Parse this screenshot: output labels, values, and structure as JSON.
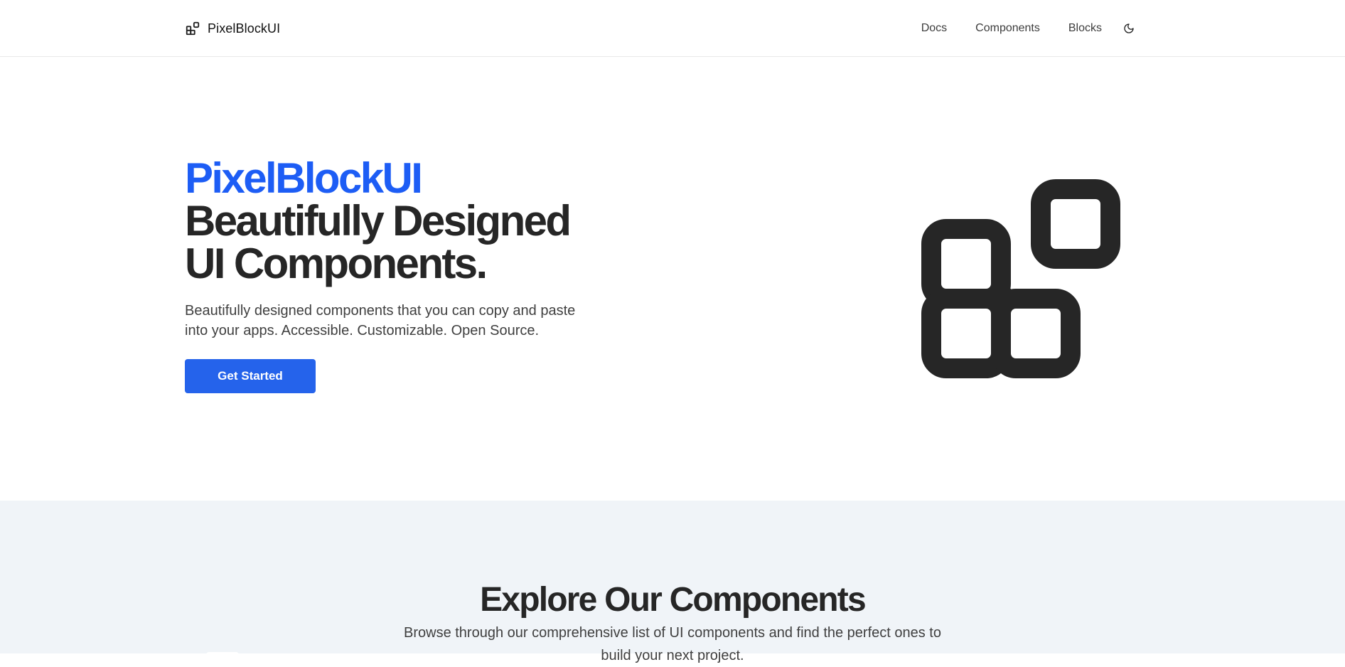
{
  "navbar": {
    "brand_name": "PixelBlockUI",
    "brand_icon": "blocks-icon",
    "links": [
      "Docs",
      "Components",
      "Blocks"
    ],
    "theme_toggle_icon": "moon-icon"
  },
  "hero": {
    "brand": "PixelBlockUI",
    "title_line1": "Beautifully Designed",
    "title_line2": "UI Components.",
    "description": "Beautifully designed components that you can copy and paste into your apps. Accessible. Customizable. Open Source.",
    "cta_label": "Get Started",
    "illustration_icon": "blocks-icon"
  },
  "explore": {
    "title": "Explore Our Components",
    "description": "Browse through our comprehensive list of UI components and find the perfect ones to build your next project."
  },
  "colors": {
    "accent": "#2563eb",
    "brand_text": "#1d5df5",
    "heading": "#262626",
    "section_bg": "#f0f4f8"
  }
}
